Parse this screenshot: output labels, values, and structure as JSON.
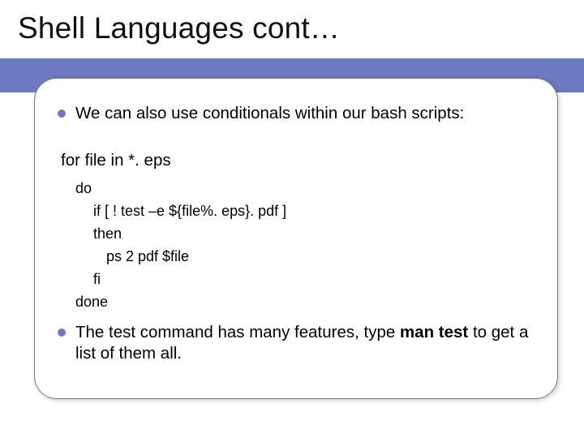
{
  "slide": {
    "title": "Shell Languages cont…"
  },
  "bullets": {
    "b1": "We can also use conditionals within our bash scripts:",
    "b2_pre": "The test command has many features, type ",
    "b2_bold": "man test",
    "b2_post": " to get a list of them all."
  },
  "code": {
    "line1": "for file in *. eps",
    "line2": "do",
    "line3": "if [ ! test –e ${file%. eps}. pdf ]",
    "line4": "then",
    "line5": "ps 2 pdf $file",
    "line6": "fi",
    "line7": "done"
  }
}
